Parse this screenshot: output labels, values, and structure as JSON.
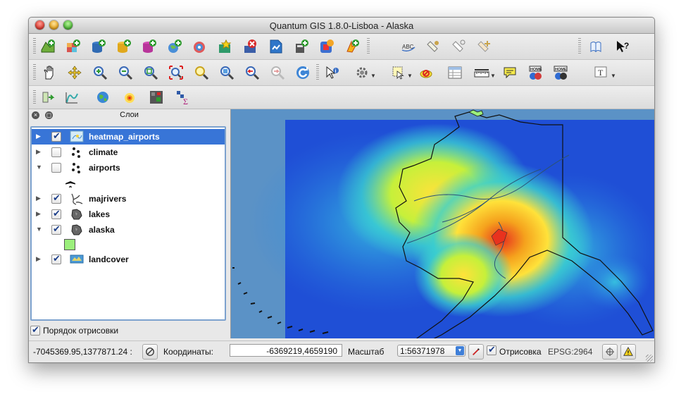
{
  "window": {
    "title": "Quantum GIS 1.8.0-Lisboa - Alaska"
  },
  "layers_panel": {
    "title": "Слои",
    "layers": [
      {
        "name": "heatmap_airports",
        "checked": true,
        "expanded": false,
        "selected": true
      },
      {
        "name": "climate",
        "checked": false,
        "expanded": false,
        "selected": false
      },
      {
        "name": "airports",
        "checked": false,
        "expanded": true,
        "selected": false
      },
      {
        "name": "majrivers",
        "checked": true,
        "expanded": false,
        "selected": false
      },
      {
        "name": "lakes",
        "checked": true,
        "expanded": false,
        "selected": false
      },
      {
        "name": "alaska",
        "checked": true,
        "expanded": true,
        "selected": false
      },
      {
        "name": "landcover",
        "checked": true,
        "expanded": false,
        "selected": false
      }
    ],
    "render_order_label": "Порядок отрисовки",
    "render_order_checked": true
  },
  "statusbar": {
    "cursor_coords": "-7045369.95,1377871.24 :",
    "coords_label": "Координаты:",
    "coords_value": "-6369219,4659190",
    "scale_label": "Масштаб",
    "scale_value": "1:56371978",
    "render_label": "Отрисовка",
    "render_checked": true,
    "crs_label": "EPSG:2964"
  },
  "colors": {
    "map_background": "#5b92c6",
    "heatmap_low": "#1f4fd6",
    "heatmap_mid": "#3ad0d0",
    "heatmap_high": "#ffe23a",
    "heatmap_peak": "#e8321e",
    "selection": "#3875d7",
    "alaska_fill": "#9bef7c"
  }
}
